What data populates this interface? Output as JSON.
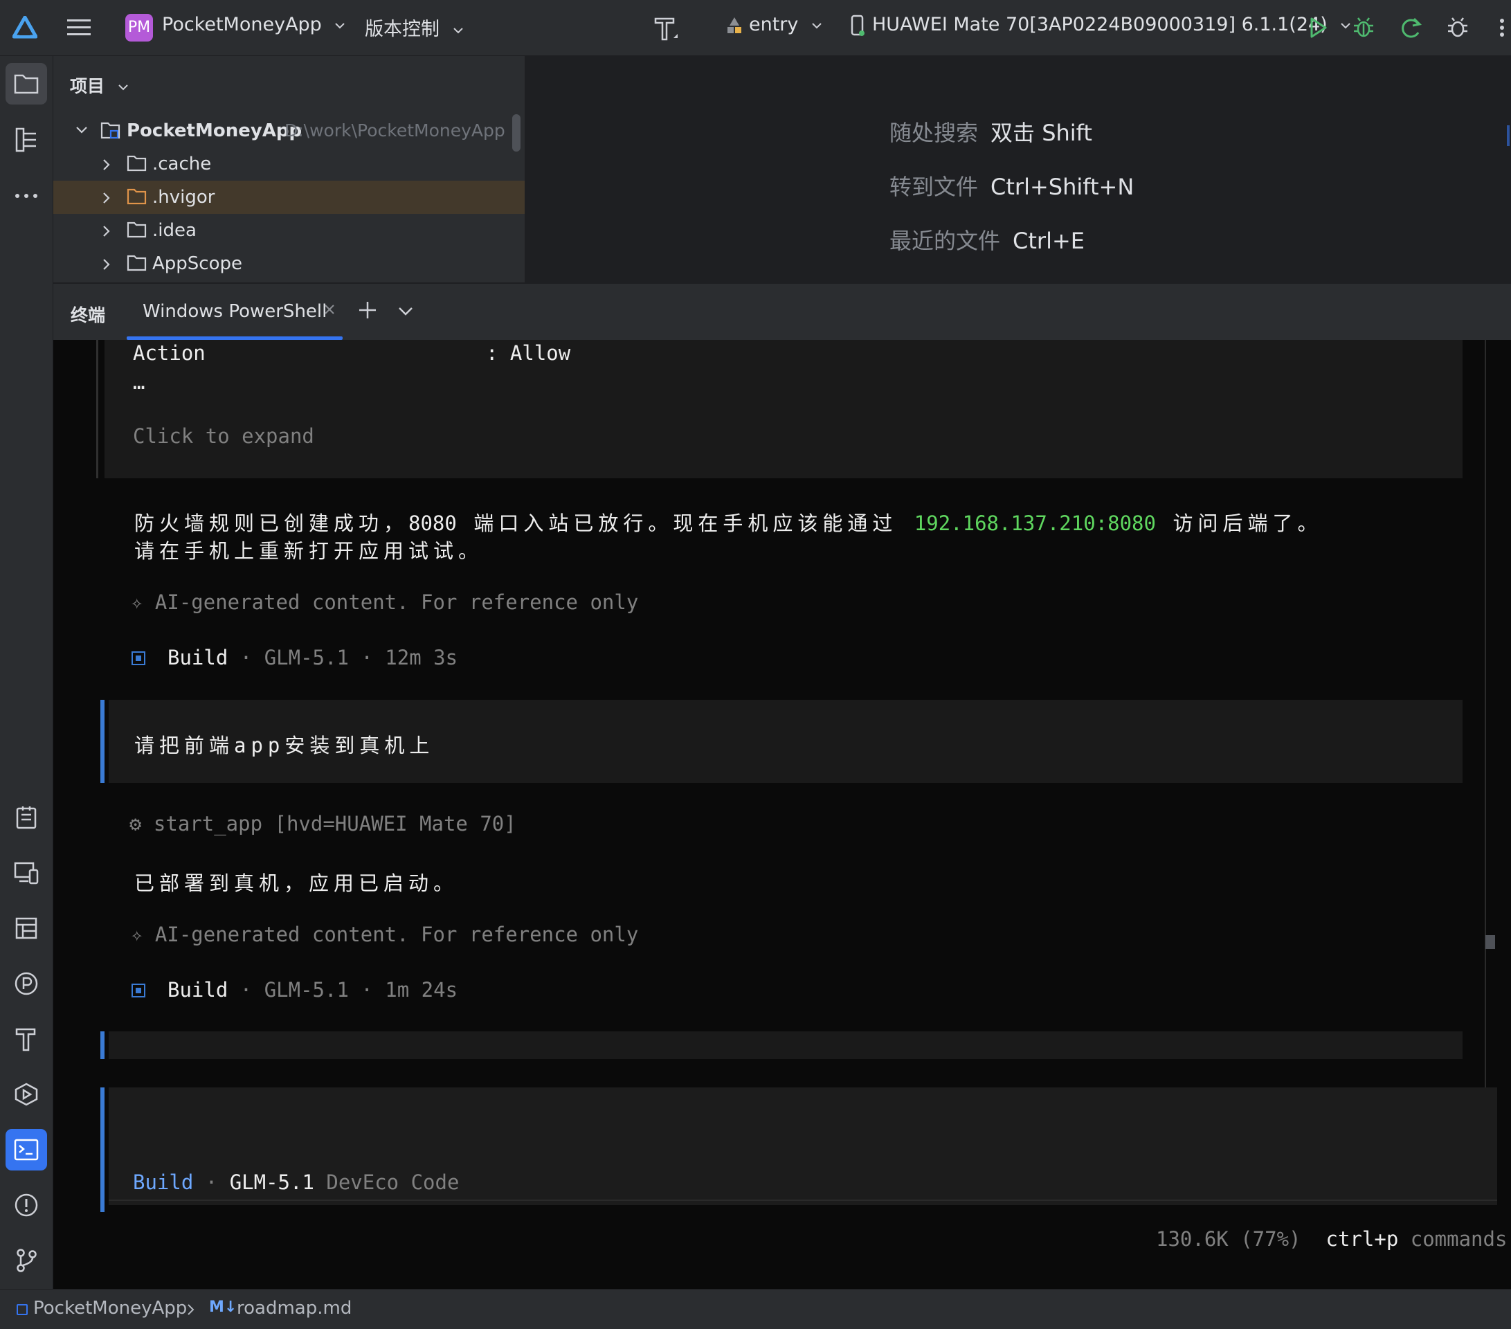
{
  "topbar": {
    "project_badge": "PM",
    "project_name": "PocketMoneyApp",
    "vcs_label": "版本控制",
    "module_label": "entry",
    "device_label": "HUAWEI Mate 70[3AP0224B09000319] 6.1.1(24)"
  },
  "project_panel": {
    "title": "项目",
    "root_name": "PocketMoneyApp",
    "root_path": "D:\\work\\PocketMoneyApp",
    "items": [
      {
        "label": ".cache"
      },
      {
        "label": ".hvigor"
      },
      {
        "label": ".idea"
      },
      {
        "label": "AppScope"
      }
    ]
  },
  "editor_hints": [
    {
      "action": "随处搜索",
      "shortcut": "双击 Shift"
    },
    {
      "action": "转到文件",
      "shortcut": "Ctrl+Shift+N"
    },
    {
      "action": "最近的文件",
      "shortcut": "Ctrl+E"
    }
  ],
  "terminal_header": {
    "title": "终端",
    "tab_label": "Windows PowerShell"
  },
  "terminal": {
    "action_key": "Action",
    "action_value": ": Allow",
    "ellipsis": "…",
    "click_to_expand": "Click to expand",
    "msg1_part1": "防火墙规则已创建成功，",
    "msg1_port": "8080",
    "msg1_part2": " 端口入站已放行。现在手机应该能通过 ",
    "msg1_addr": "192.168.137.210:8080",
    "msg1_part3": " 访问后端了。",
    "msg1_line2": "请在手机上重新打开应用试试。",
    "ai_note_1": "✧ AI-generated content. For reference only",
    "build1_label": "Build",
    "build1_meta": " · GLM-5.1 · 12m 3s",
    "user_prompt": "请把前端app安装到真机上",
    "tool_call": "⚙ start_app [hvd=HUAWEI Mate 70]",
    "msg2": "已部署到真机，应用已启动。",
    "ai_note_2": "✧ AI-generated content. For reference only",
    "build2_label": "Build",
    "build2_meta": " · GLM-5.1 · 1m 24s",
    "input_mode": "Build",
    "input_sep": " · ",
    "input_model": "GLM-5.1",
    "input_provider": " DevEco Code",
    "tokens": "130.6K (77%)",
    "cmd_key": "ctrl+p",
    "cmd_label": " commands"
  },
  "statusbar": {
    "project": "PocketMoneyApp",
    "md_badge": "M↓",
    "file": "roadmap.md"
  },
  "colors": {
    "accent_blue": "#3574f0",
    "ip_green": "#5fd75f",
    "run_green": "#4fba6f",
    "selection_brown": "#43392b"
  }
}
